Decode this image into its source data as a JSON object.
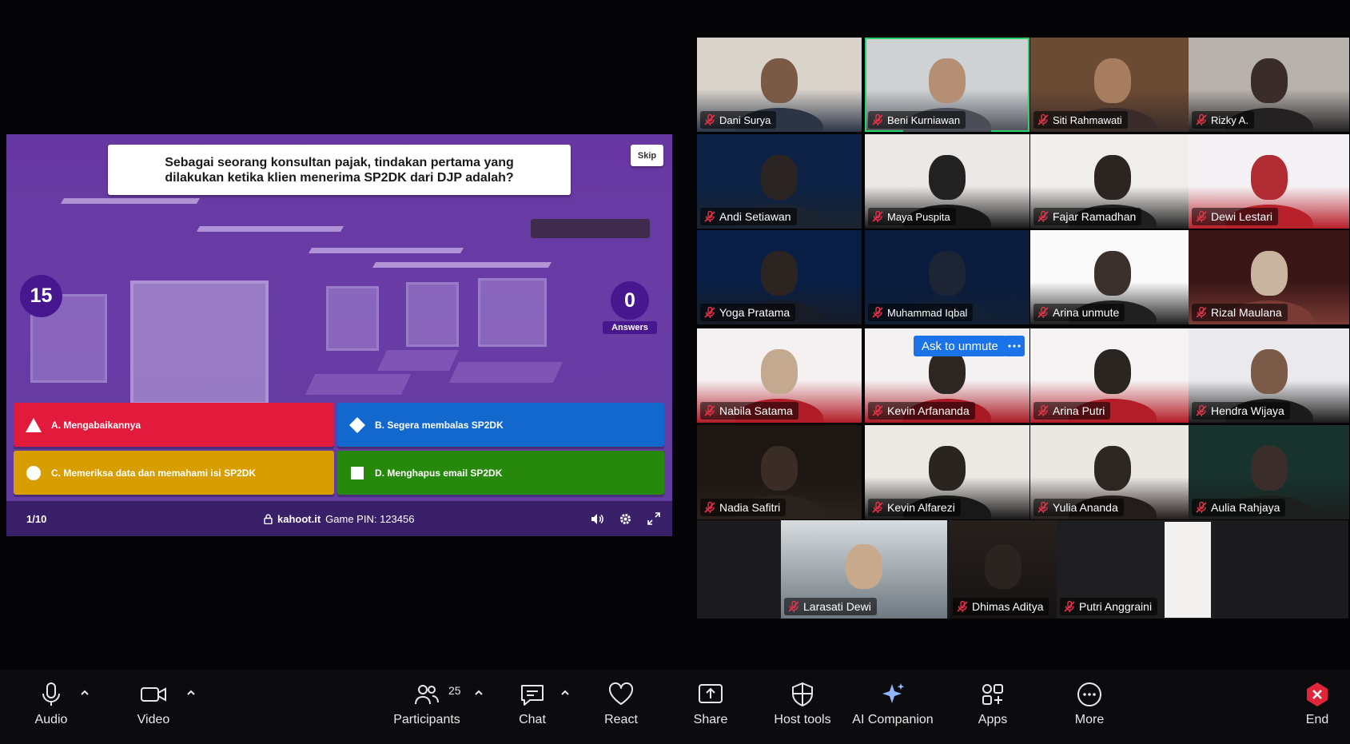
{
  "kahoot": {
    "question": "Sebagai seorang konsultan pajak, tindakan pertama yang dilakukan ketika klien menerima SP2DK dari DJP adalah?",
    "skip_label": "Skip",
    "timer": "15",
    "answers_count": "0",
    "answers_label": "Answers",
    "options": [
      {
        "label": "A. Mengabaikannya",
        "shape": "triangle-icon",
        "color": "#e21b3c"
      },
      {
        "label": "B. Segera membalas SP2DK",
        "shape": "diamond-icon",
        "color": "#1368ce"
      },
      {
        "label": "C. Memeriksa data dan memahami isi SP2DK",
        "shape": "circle-icon",
        "color": "#d89e00"
      },
      {
        "label": "D. Menghapus email SP2DK",
        "shape": "square-icon",
        "color": "#26890c"
      }
    ],
    "progress": "1/10",
    "site": "kahoot.it",
    "pin": "Game PIN: 123456"
  },
  "gallery": {
    "participants": [
      {
        "name": "Dani Surya"
      },
      {
        "name": "Beni Kurniawan"
      },
      {
        "name": "Siti Rahmawati"
      },
      {
        "name": "Rizky A."
      },
      {
        "name": "Andi Setiawan"
      },
      {
        "name": "Maya Puspita"
      },
      {
        "name": "Fajar Ramadhan"
      },
      {
        "name": "Dewi Lestari"
      },
      {
        "name": "Yoga Pratama"
      },
      {
        "name": "Muhammad Iqbal"
      },
      {
        "name": "Arina unmute"
      },
      {
        "name": "Rizal Maulana"
      },
      {
        "name": "Nabila Satama"
      },
      {
        "name": "Kevin Arfananda"
      },
      {
        "name": "Arina Putri"
      },
      {
        "name": "Hendra Wijaya"
      },
      {
        "name": "Nadia Safitri"
      },
      {
        "name": "Kevin Alfarezi"
      },
      {
        "name": "Yulia Ananda"
      },
      {
        "name": "Aulia Rahjaya"
      },
      {
        "name": "Larasati Dewi"
      },
      {
        "name": "Dhimas Aditya"
      },
      {
        "name": "Putri Anggraini"
      }
    ],
    "ask_to_unmute": "Ask to unmute",
    "active_speaker_color": "#2bd26b"
  },
  "toolbar": {
    "audio": "Audio",
    "video": "Video",
    "participants": "Participants",
    "participant_count": "25",
    "chat": "Chat",
    "react": "React",
    "share": "Share",
    "host_tools": "Host tools",
    "ai_companion": "AI Companion",
    "apps": "Apps",
    "more": "More",
    "end": "End"
  }
}
